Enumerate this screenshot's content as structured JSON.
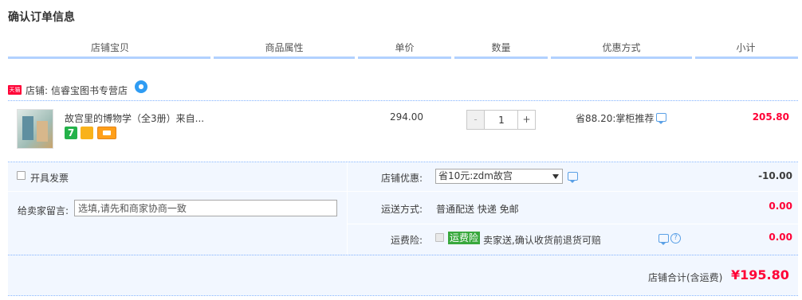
{
  "page_title": "确认订单信息",
  "columns": [
    "店铺宝贝",
    "商品属性",
    "单价",
    "数量",
    "优惠方式",
    "小计"
  ],
  "shop": {
    "badge": "天猫",
    "prefix": "店铺:",
    "name": "信睿宝图书专营店"
  },
  "item": {
    "title": "故宫里的博物学（全3册）来自...",
    "service_icons": [
      "seven-day-return-icon",
      "guarantee-icon",
      "credit-card-icon"
    ],
    "service_seven_label": "7",
    "unit_price": "294.00",
    "quantity": "1",
    "minus_label": "-",
    "plus_label": "+",
    "discount": "省88.20:掌柜推荐",
    "subtotal": "205.80"
  },
  "invoice": {
    "label": "开具发票"
  },
  "message": {
    "label": "给卖家留言:",
    "placeholder": "选填,请先和商家协商一致"
  },
  "coupon": {
    "label": "店铺优惠:",
    "selected": "省10元:zdm故宫",
    "amount": "-10.00"
  },
  "shipping": {
    "label": "运送方式:",
    "method": "普通配送 快递 免邮",
    "amount": "0.00"
  },
  "insurance": {
    "label": "运费险:",
    "badge": "运费险",
    "text": "卖家送,确认收货前退货可赔",
    "amount": "0.00"
  },
  "total": {
    "label": "店铺合计(含运费)",
    "value": "¥195.80"
  },
  "colors": {
    "accent_blue": "#b2d1ff",
    "price_red": "#ff0036",
    "panel_bg": "#f2f7ff",
    "insurance_green": "#38a83c"
  }
}
